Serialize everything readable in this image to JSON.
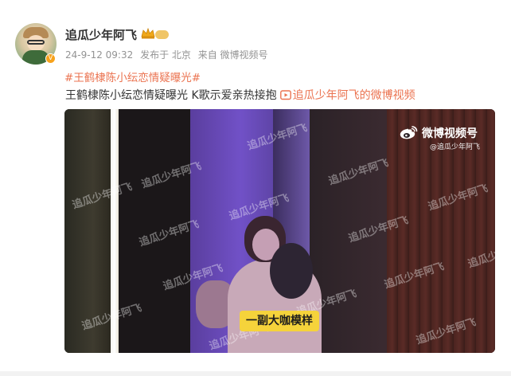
{
  "post": {
    "author": {
      "name": "追瓜少年阿飞",
      "verified": true
    },
    "meta": {
      "timestamp": "24-9-12 09:32",
      "location": "发布于 北京",
      "source": "来自 微博视频号"
    },
    "hashtag": "#王鹤棣陈小纭恋情疑曝光#",
    "text": "王鹤棣陈小纭恋情疑曝光 K歌示爱亲热接抱",
    "video_link_label": "追瓜少年阿飞的微博视频"
  },
  "video": {
    "logo_text": "微博视频号",
    "channel_handle": "@追瓜少年阿飞",
    "watermark_text": "追瓜少年阿飞",
    "subtitle": "一副大咖模样"
  },
  "colors": {
    "accent_orange": "#eb7350",
    "text_dark": "#333333",
    "meta_gray": "#939393",
    "subtitle_yellow": "#f5d33b"
  },
  "icons": {
    "verify": "verified-badge-icon",
    "vip": "vip-crown-icon",
    "video_link": "video-link-icon",
    "logo": "weibo-eye-icon"
  }
}
